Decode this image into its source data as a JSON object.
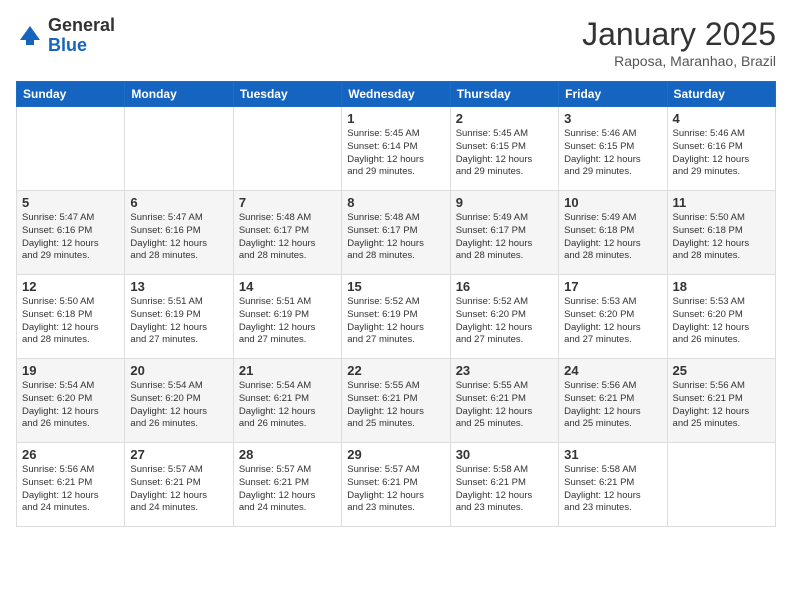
{
  "header": {
    "logo_general": "General",
    "logo_blue": "Blue",
    "month": "January 2025",
    "location": "Raposa, Maranhao, Brazil"
  },
  "days_of_week": [
    "Sunday",
    "Monday",
    "Tuesday",
    "Wednesday",
    "Thursday",
    "Friday",
    "Saturday"
  ],
  "weeks": [
    [
      {
        "num": "",
        "info": ""
      },
      {
        "num": "",
        "info": ""
      },
      {
        "num": "",
        "info": ""
      },
      {
        "num": "1",
        "info": "Sunrise: 5:45 AM\nSunset: 6:14 PM\nDaylight: 12 hours\nand 29 minutes."
      },
      {
        "num": "2",
        "info": "Sunrise: 5:45 AM\nSunset: 6:15 PM\nDaylight: 12 hours\nand 29 minutes."
      },
      {
        "num": "3",
        "info": "Sunrise: 5:46 AM\nSunset: 6:15 PM\nDaylight: 12 hours\nand 29 minutes."
      },
      {
        "num": "4",
        "info": "Sunrise: 5:46 AM\nSunset: 6:16 PM\nDaylight: 12 hours\nand 29 minutes."
      }
    ],
    [
      {
        "num": "5",
        "info": "Sunrise: 5:47 AM\nSunset: 6:16 PM\nDaylight: 12 hours\nand 29 minutes."
      },
      {
        "num": "6",
        "info": "Sunrise: 5:47 AM\nSunset: 6:16 PM\nDaylight: 12 hours\nand 28 minutes."
      },
      {
        "num": "7",
        "info": "Sunrise: 5:48 AM\nSunset: 6:17 PM\nDaylight: 12 hours\nand 28 minutes."
      },
      {
        "num": "8",
        "info": "Sunrise: 5:48 AM\nSunset: 6:17 PM\nDaylight: 12 hours\nand 28 minutes."
      },
      {
        "num": "9",
        "info": "Sunrise: 5:49 AM\nSunset: 6:17 PM\nDaylight: 12 hours\nand 28 minutes."
      },
      {
        "num": "10",
        "info": "Sunrise: 5:49 AM\nSunset: 6:18 PM\nDaylight: 12 hours\nand 28 minutes."
      },
      {
        "num": "11",
        "info": "Sunrise: 5:50 AM\nSunset: 6:18 PM\nDaylight: 12 hours\nand 28 minutes."
      }
    ],
    [
      {
        "num": "12",
        "info": "Sunrise: 5:50 AM\nSunset: 6:18 PM\nDaylight: 12 hours\nand 28 minutes."
      },
      {
        "num": "13",
        "info": "Sunrise: 5:51 AM\nSunset: 6:19 PM\nDaylight: 12 hours\nand 27 minutes."
      },
      {
        "num": "14",
        "info": "Sunrise: 5:51 AM\nSunset: 6:19 PM\nDaylight: 12 hours\nand 27 minutes."
      },
      {
        "num": "15",
        "info": "Sunrise: 5:52 AM\nSunset: 6:19 PM\nDaylight: 12 hours\nand 27 minutes."
      },
      {
        "num": "16",
        "info": "Sunrise: 5:52 AM\nSunset: 6:20 PM\nDaylight: 12 hours\nand 27 minutes."
      },
      {
        "num": "17",
        "info": "Sunrise: 5:53 AM\nSunset: 6:20 PM\nDaylight: 12 hours\nand 27 minutes."
      },
      {
        "num": "18",
        "info": "Sunrise: 5:53 AM\nSunset: 6:20 PM\nDaylight: 12 hours\nand 26 minutes."
      }
    ],
    [
      {
        "num": "19",
        "info": "Sunrise: 5:54 AM\nSunset: 6:20 PM\nDaylight: 12 hours\nand 26 minutes."
      },
      {
        "num": "20",
        "info": "Sunrise: 5:54 AM\nSunset: 6:20 PM\nDaylight: 12 hours\nand 26 minutes."
      },
      {
        "num": "21",
        "info": "Sunrise: 5:54 AM\nSunset: 6:21 PM\nDaylight: 12 hours\nand 26 minutes."
      },
      {
        "num": "22",
        "info": "Sunrise: 5:55 AM\nSunset: 6:21 PM\nDaylight: 12 hours\nand 25 minutes."
      },
      {
        "num": "23",
        "info": "Sunrise: 5:55 AM\nSunset: 6:21 PM\nDaylight: 12 hours\nand 25 minutes."
      },
      {
        "num": "24",
        "info": "Sunrise: 5:56 AM\nSunset: 6:21 PM\nDaylight: 12 hours\nand 25 minutes."
      },
      {
        "num": "25",
        "info": "Sunrise: 5:56 AM\nSunset: 6:21 PM\nDaylight: 12 hours\nand 25 minutes."
      }
    ],
    [
      {
        "num": "26",
        "info": "Sunrise: 5:56 AM\nSunset: 6:21 PM\nDaylight: 12 hours\nand 24 minutes."
      },
      {
        "num": "27",
        "info": "Sunrise: 5:57 AM\nSunset: 6:21 PM\nDaylight: 12 hours\nand 24 minutes."
      },
      {
        "num": "28",
        "info": "Sunrise: 5:57 AM\nSunset: 6:21 PM\nDaylight: 12 hours\nand 24 minutes."
      },
      {
        "num": "29",
        "info": "Sunrise: 5:57 AM\nSunset: 6:21 PM\nDaylight: 12 hours\nand 23 minutes."
      },
      {
        "num": "30",
        "info": "Sunrise: 5:58 AM\nSunset: 6:21 PM\nDaylight: 12 hours\nand 23 minutes."
      },
      {
        "num": "31",
        "info": "Sunrise: 5:58 AM\nSunset: 6:21 PM\nDaylight: 12 hours\nand 23 minutes."
      },
      {
        "num": "",
        "info": ""
      }
    ]
  ]
}
